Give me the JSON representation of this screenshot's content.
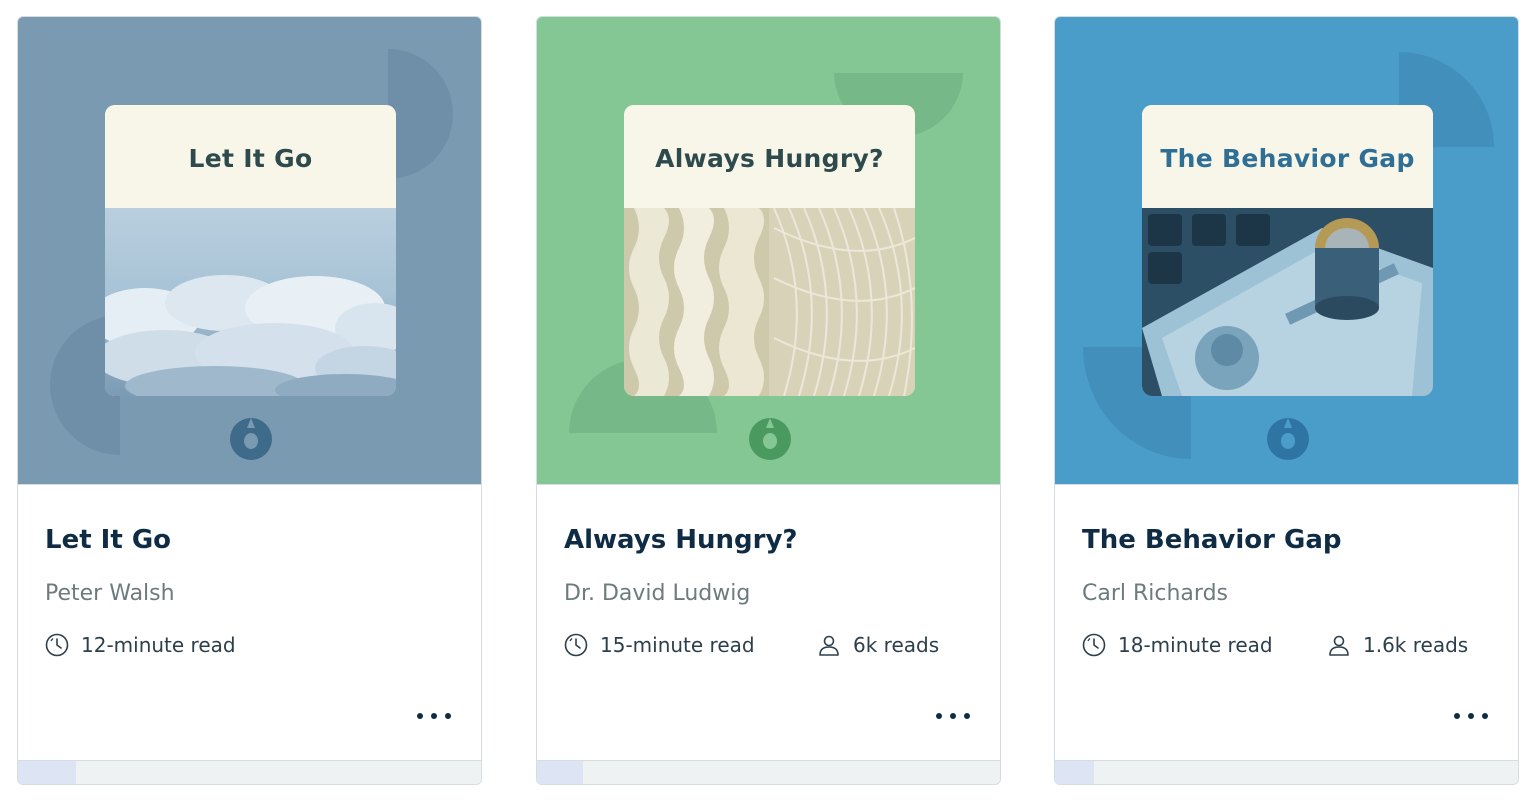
{
  "cards": [
    {
      "cover_title": "Let It Go",
      "title": "Let It Go",
      "author": "Peter Walsh",
      "read_time": "12-minute read",
      "reads": null,
      "progress_fraction": 0.125,
      "colors": {
        "background": "#7a9ab2",
        "cover_title": "#2e4a4d",
        "logo": "#3f6b8a"
      },
      "image": "clouds-image"
    },
    {
      "cover_title": "Always Hungry?",
      "title": "Always Hungry?",
      "author": "Dr. David Ludwig",
      "read_time": "15-minute read",
      "reads": "6k reads",
      "progress_fraction": 0.1,
      "colors": {
        "background": "#84c795",
        "cover_title": "#2e4a4d",
        "logo": "#4a9a5f"
      },
      "image": "noodles-image"
    },
    {
      "cover_title": "The Behavior Gap",
      "title": "The Behavior Gap",
      "author": "Carl Richards",
      "read_time": "18-minute read",
      "reads": "1.6k reads",
      "progress_fraction": 0.085,
      "colors": {
        "background": "#4a9dc9",
        "cover_title": "#2f6f96",
        "logo": "#2f75a3"
      },
      "image": "money-image"
    }
  ],
  "icons": {
    "clock": "clock-icon",
    "person": "person-icon",
    "more": "more-options-icon",
    "logo": "brand-logo-icon"
  }
}
